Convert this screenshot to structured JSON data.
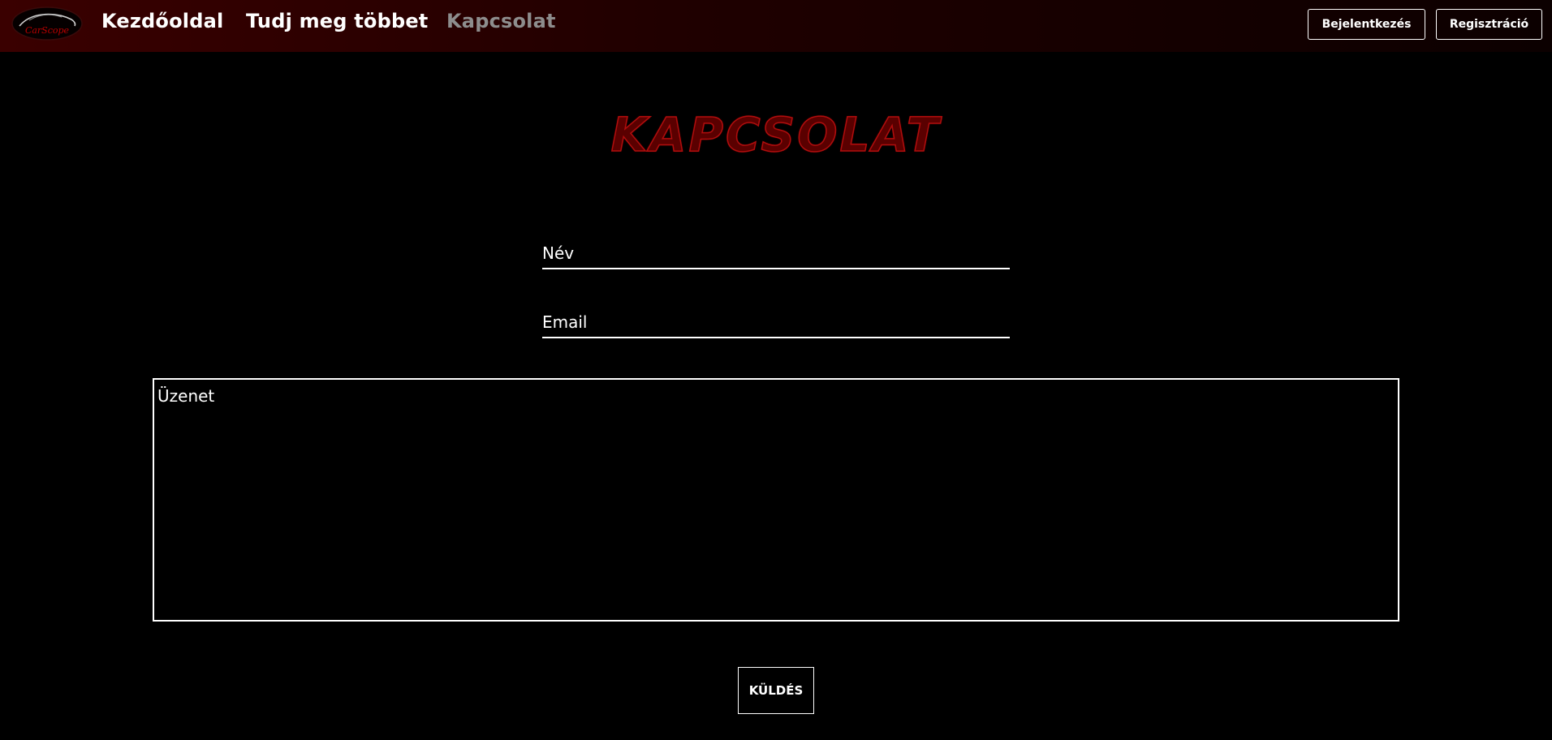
{
  "brand": {
    "logo_text": "CarScope"
  },
  "nav": {
    "links": [
      {
        "label": "Kezdőoldal"
      },
      {
        "label": "Tudj meg többet"
      },
      {
        "label": "Kapcsolat"
      }
    ],
    "login_label": "Bejelentkezés",
    "register_label": "Regisztráció"
  },
  "contact": {
    "title": "KAPCSOLAT",
    "name_placeholder": "Név",
    "email_placeholder": "Email",
    "message_placeholder": "Üzenet",
    "send_label": "KÜLDÉS"
  },
  "colors": {
    "nav_gradient_start": "#3a0000",
    "title_red": "#b10d0d",
    "active_link": "#8d8d8d"
  }
}
